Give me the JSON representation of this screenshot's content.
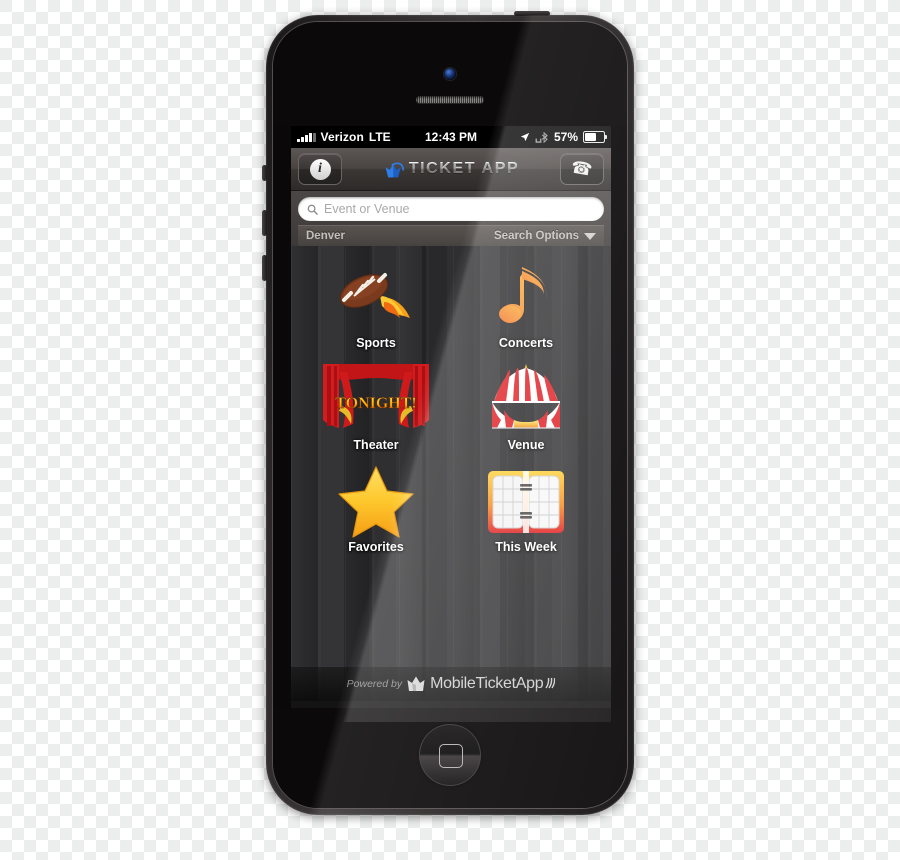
{
  "device": {
    "name": "iPhone 5",
    "home_button": "home-button",
    "camera": "front-camera",
    "earpiece": "earpiece-speaker"
  },
  "status_bar": {
    "signal": "signal-bars",
    "carrier": "Verizon",
    "network": "LTE",
    "time": "12:43 PM",
    "location_icon": "location-arrow-icon",
    "bluetooth_icon": "bluetooth-icon",
    "battery_percent": "57%",
    "battery_level": 57
  },
  "app_header": {
    "info_button": "i",
    "logo_icon": "ticket-logo-icon",
    "title": "TICKET APP",
    "phone_button": "☎"
  },
  "search": {
    "icon": "search-icon",
    "placeholder": "Event or Venue",
    "value": "",
    "location": "Denver",
    "options_label": "Search Options",
    "caret": "chevron-down-icon"
  },
  "tiles": [
    {
      "id": "sports",
      "label": "Sports",
      "icon": "flaming-football-icon"
    },
    {
      "id": "concerts",
      "label": "Concerts",
      "icon": "music-note-icon"
    },
    {
      "id": "theater",
      "label": "Theater",
      "icon": "stage-curtains-icon",
      "marquee": "TONIGHT!"
    },
    {
      "id": "venue",
      "label": "Venue",
      "icon": "circus-tent-icon"
    },
    {
      "id": "favorites",
      "label": "Favorites",
      "icon": "star-icon"
    },
    {
      "id": "this_week",
      "label": "This Week",
      "icon": "planner-book-icon"
    }
  ],
  "footer": {
    "powered_by": "Powered by",
    "brand": "MobileTicketApp",
    "brand_icon": "ticket-stub-icon",
    "signal_icon": "wifi-waves-icon"
  },
  "colors": {
    "accent_orange": "#f5a623",
    "accent_red": "#cc1111",
    "star_gold": "#ffc425",
    "wood_bg": "#2e2e30",
    "chrome": "#4a4543"
  }
}
